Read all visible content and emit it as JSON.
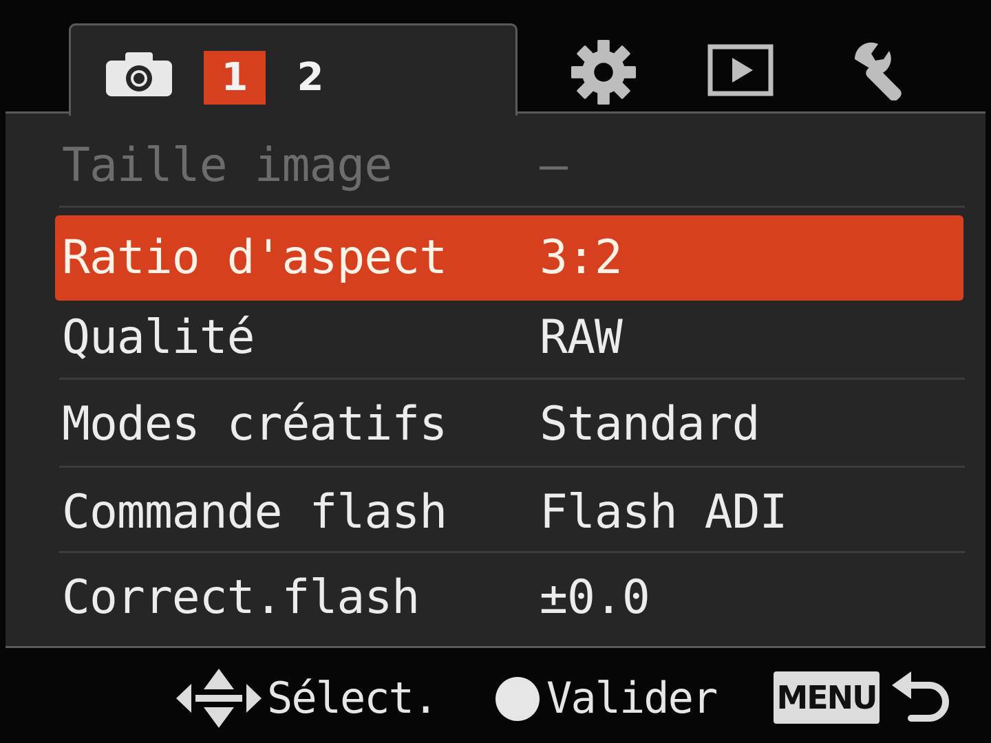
{
  "tabs": {
    "camera_icon": "camera-icon",
    "pages": [
      {
        "label": "1",
        "active": true
      },
      {
        "label": "2",
        "active": false
      }
    ],
    "other_icons": [
      "gear-icon",
      "play-icon",
      "wrench-icon"
    ]
  },
  "menu": {
    "rows": [
      {
        "label": "Taille image",
        "value": "–",
        "state": "disabled"
      },
      {
        "label": "Ratio d'aspect",
        "value": "3:2",
        "state": "selected"
      },
      {
        "label": "Qualité",
        "value": "RAW",
        "state": "normal"
      },
      {
        "label": "Modes créatifs",
        "value": "Standard",
        "state": "normal"
      },
      {
        "label": "Commande flash",
        "value": "Flash ADI",
        "state": "normal"
      },
      {
        "label": "Correct.flash",
        "value": "±0.0",
        "state": "normal"
      }
    ]
  },
  "footer": {
    "select_label": "Sélect.",
    "validate_label": "Valider",
    "menu_label": "MENU"
  },
  "colors": {
    "accent": "#d7401f",
    "panel": "#262626",
    "background": "#060606",
    "text": "#ececec",
    "disabled_text": "#6c6c6c"
  }
}
